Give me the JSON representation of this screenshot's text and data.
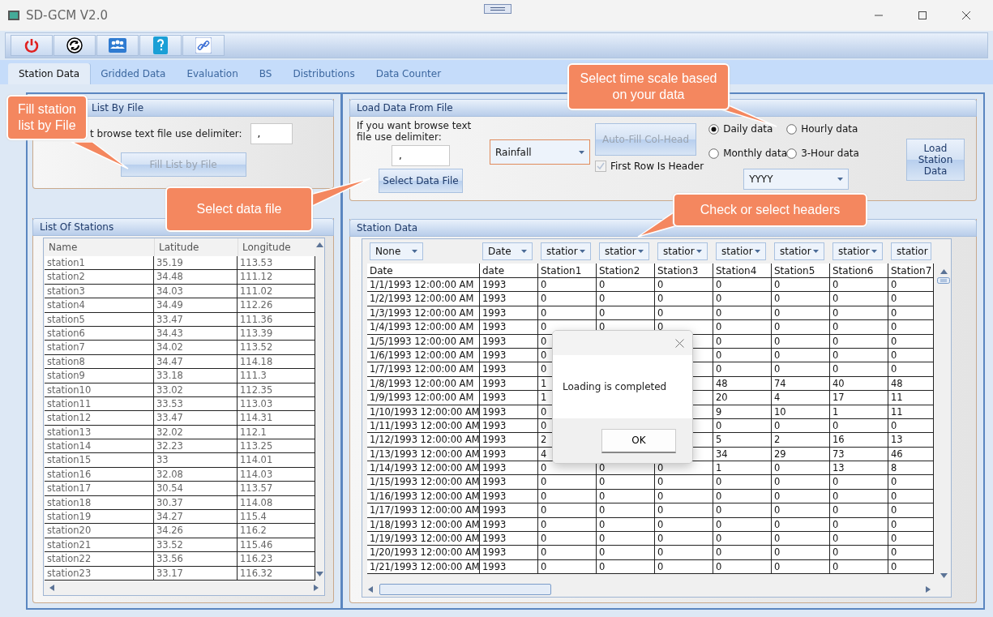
{
  "window": {
    "title": "SD-GCM V2.0"
  },
  "tabs": [
    {
      "label": "Station Data",
      "selected": true
    },
    {
      "label": "Gridded Data",
      "selected": false
    },
    {
      "label": "Evaluation",
      "selected": false
    },
    {
      "label": "BS",
      "selected": false
    },
    {
      "label": "Distributions",
      "selected": false
    },
    {
      "label": "Data Counter",
      "selected": false
    }
  ],
  "file_list_panel": {
    "title": "List By File",
    "prompt": "t browse text file use delimiter:",
    "delimiter": ",",
    "button": {
      "label": "Fill List by File",
      "disabled": true
    }
  },
  "load_panel": {
    "title": "Load Data From File",
    "prompt": "If you want browse text file use delimiter:",
    "delimiter": ",",
    "select_button": "Select Data File",
    "variable": "Rainfall",
    "auto_fill_button": {
      "label": "Auto-Fill Col-Head",
      "disabled": true
    },
    "first_row_header": {
      "label": "First Row Is Header",
      "checked": true,
      "disabled": true
    },
    "time_scales": [
      {
        "label": "Daily data",
        "selected": true
      },
      {
        "label": "Hourly data",
        "selected": false
      },
      {
        "label": "Monthly data",
        "selected": false
      },
      {
        "label": "3-Hour data",
        "selected": false
      }
    ],
    "date_format": "YYYY",
    "load_button": "Load Station Data"
  },
  "stations_table": {
    "title": "List Of Stations",
    "columns": [
      "Name",
      "Latitude",
      "Longitude"
    ],
    "rows": [
      [
        "station1",
        "35.19",
        "113.53"
      ],
      [
        "station2",
        "34.48",
        "111.12"
      ],
      [
        "station3",
        "34.03",
        "111.02"
      ],
      [
        "station4",
        "34.49",
        "112.26"
      ],
      [
        "station5",
        "33.47",
        "111.36"
      ],
      [
        "station6",
        "34.43",
        "113.39"
      ],
      [
        "station7",
        "34.02",
        "113.52"
      ],
      [
        "station8",
        "34.47",
        "114.18"
      ],
      [
        "station9",
        "33.18",
        "111.3"
      ],
      [
        "station10",
        "33.02",
        "112.35"
      ],
      [
        "station11",
        "33.53",
        "113.03"
      ],
      [
        "station12",
        "33.47",
        "114.31"
      ],
      [
        "station13",
        "32.02",
        "112.1"
      ],
      [
        "station14",
        "32.23",
        "113.25"
      ],
      [
        "station15",
        "33",
        "114.01"
      ],
      [
        "station16",
        "32.08",
        "114.03"
      ],
      [
        "station17",
        "30.54",
        "113.57"
      ],
      [
        "station18",
        "30.37",
        "114.08"
      ],
      [
        "station19",
        "34.27",
        "115.4"
      ],
      [
        "station20",
        "34.26",
        "116.2"
      ],
      [
        "station21",
        "33.52",
        "115.46"
      ],
      [
        "station22",
        "33.56",
        "116.23"
      ],
      [
        "station23",
        "33.17",
        "116.32"
      ]
    ]
  },
  "data_table": {
    "title": "Station Data",
    "selectors": [
      "None",
      "Date",
      "statior",
      "statior",
      "statior",
      "statior",
      "statior",
      "statior",
      "statior"
    ],
    "columns": [
      "Date",
      "date",
      "Station1",
      "Station2",
      "Station3",
      "Station4",
      "Station5",
      "Station6",
      "Station7"
    ],
    "rows": [
      [
        "1/1/1993 12:00:00 AM",
        "1993",
        "0",
        "0",
        "0",
        "0",
        "0",
        "0",
        "0"
      ],
      [
        "1/2/1993 12:00:00 AM",
        "1993",
        "0",
        "0",
        "0",
        "0",
        "0",
        "0",
        "0"
      ],
      [
        "1/3/1993 12:00:00 AM",
        "1993",
        "0",
        "0",
        "0",
        "0",
        "0",
        "0",
        "0"
      ],
      [
        "1/4/1993 12:00:00 AM",
        "1993",
        "0",
        "0",
        "0",
        "0",
        "0",
        "0",
        "0"
      ],
      [
        "1/5/1993 12:00:00 AM",
        "1993",
        "0",
        null,
        null,
        "0",
        "0",
        "0",
        "0"
      ],
      [
        "1/6/1993 12:00:00 AM",
        "1993",
        "0",
        null,
        null,
        "0",
        "0",
        "0",
        "0"
      ],
      [
        "1/7/1993 12:00:00 AM",
        "1993",
        "0",
        null,
        null,
        "0",
        "0",
        "0",
        "0"
      ],
      [
        "1/8/1993 12:00:00 AM",
        "1993",
        "1",
        null,
        null,
        "48",
        "74",
        "40",
        "48"
      ],
      [
        "1/9/1993 12:00:00 AM",
        "1993",
        "1",
        null,
        null,
        "20",
        "4",
        "17",
        "11"
      ],
      [
        "1/10/1993 12:00:00 AM",
        "1993",
        "0",
        null,
        null,
        "9",
        "10",
        "1",
        "11"
      ],
      [
        "1/11/1993 12:00:00 AM",
        "1993",
        "0",
        null,
        null,
        "0",
        "0",
        "0",
        "0"
      ],
      [
        "1/12/1993 12:00:00 AM",
        "1993",
        "2",
        null,
        null,
        "5",
        "2",
        "16",
        "13"
      ],
      [
        "1/13/1993 12:00:00 AM",
        "1993",
        "4",
        null,
        null,
        "34",
        "29",
        "73",
        "46"
      ],
      [
        "1/14/1993 12:00:00 AM",
        "1993",
        "0",
        "0",
        "0",
        "1",
        "0",
        "13",
        "8"
      ],
      [
        "1/15/1993 12:00:00 AM",
        "1993",
        "0",
        "0",
        "0",
        "0",
        "0",
        "0",
        "0"
      ],
      [
        "1/16/1993 12:00:00 AM",
        "1993",
        "0",
        "0",
        "0",
        "0",
        "0",
        "0",
        "0"
      ],
      [
        "1/17/1993 12:00:00 AM",
        "1993",
        "0",
        "0",
        "0",
        "0",
        "0",
        "0",
        "0"
      ],
      [
        "1/18/1993 12:00:00 AM",
        "1993",
        "0",
        "0",
        "0",
        "0",
        "0",
        "0",
        "0"
      ],
      [
        "1/19/1993 12:00:00 AM",
        "1993",
        "0",
        "0",
        "0",
        "0",
        "0",
        "0",
        "0"
      ],
      [
        "1/20/1993 12:00:00 AM",
        "1993",
        "0",
        "0",
        "0",
        "0",
        "0",
        "0",
        "0"
      ],
      [
        "1/21/1993 12:00:00 AM",
        "1993",
        "0",
        "0",
        "0",
        "0",
        "0",
        "0",
        "0"
      ]
    ]
  },
  "dialog": {
    "message": "Loading is completed",
    "button": "OK"
  },
  "callouts": [
    "Fill station list by File",
    "Select data file",
    "Select time scale based on your data",
    "Check or select headers"
  ]
}
